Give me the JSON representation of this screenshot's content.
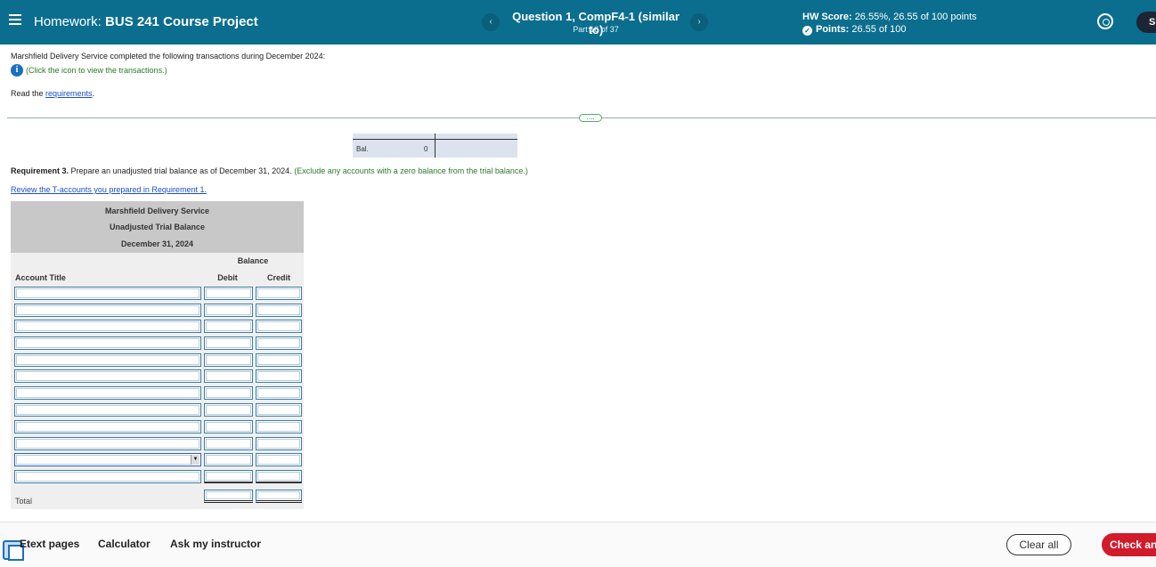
{
  "header": {
    "hw_prefix": "Homework: ",
    "course": "BUS 241 Course Project",
    "question_title": "Question 1, CompF4-1 (similar to)",
    "part": "Part 16 of 37",
    "hw_score_label": "HW Score: ",
    "hw_score_value": "26.55%, 26.55 of 100 points",
    "points_label": "Points: ",
    "points_value": "26.55 of 100",
    "avatar_initial": "S",
    "prev_glyph": "‹",
    "next_glyph": "›"
  },
  "content": {
    "intro": "Marshfield Delivery Service completed the following transactions during December 2024:",
    "info_text": "(Click the icon to view the transactions.)",
    "read_prefix": "Read the ",
    "requirements_link": "requirements",
    "read_suffix": ".",
    "more_label": "....",
    "bal_label": "Bal.",
    "bal_value": "0",
    "req3_label": "Requirement 3.",
    "req3_text": " Prepare an unadjusted trial balance as of December 31, 2024.",
    "req3_note": " (Exclude any accounts with a zero balance from the trial balance.)",
    "review_link": "Review the T-accounts you prepared in Requirement 1."
  },
  "trial_balance": {
    "company": "Marshfield Delivery Service",
    "title": "Unadjusted Trial Balance",
    "date": "December 31, 2024",
    "balance_header": "Balance",
    "account_header": "Account Title",
    "debit_header": "Debit",
    "credit_header": "Credit",
    "total_label": "Total",
    "rows": 12
  },
  "footer": {
    "etext": "Etext pages",
    "calculator": "Calculator",
    "ask": "Ask my instructor",
    "clear": "Clear all",
    "check": "Check answer"
  }
}
